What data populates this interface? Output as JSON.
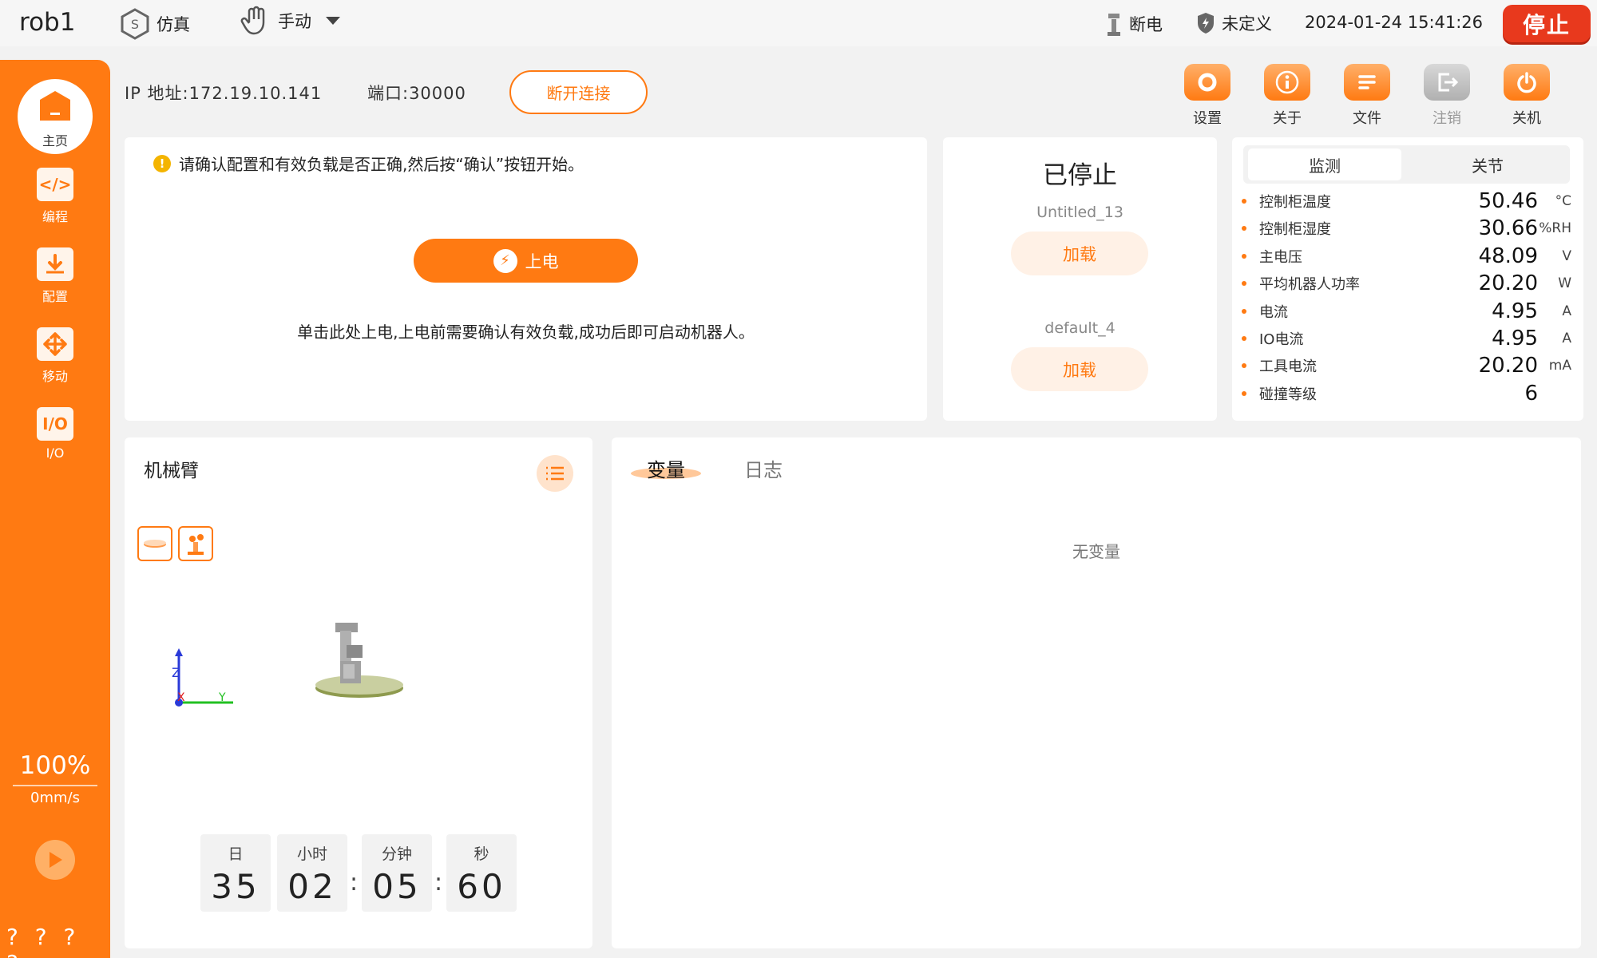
{
  "topbar": {
    "robot_name": "rob1",
    "mode": "仿真",
    "control": "手动",
    "power_status": "断电",
    "safety_status": "未定义",
    "datetime": "2024-01-24 15:41:26",
    "stop_label": "停止"
  },
  "sidebar": {
    "items": [
      {
        "label": "主页"
      },
      {
        "label": "编程",
        "icon_text": "</>"
      },
      {
        "label": "配置"
      },
      {
        "label": "移动"
      },
      {
        "label": "I/O",
        "icon_text": "I/O"
      }
    ],
    "speed_percent": "100%",
    "speed_value": "0mm/s",
    "footer": "? ? ? ?"
  },
  "connection": {
    "ip_label": "IP 地址:172.19.10.141",
    "port_label": "端口:30000",
    "disconnect_label": "断开连接"
  },
  "toolbar": {
    "items": [
      {
        "label": "设置",
        "icon": "gear-icon"
      },
      {
        "label": "关于",
        "icon": "info-icon"
      },
      {
        "label": "文件",
        "icon": "file-icon"
      },
      {
        "label": "注销",
        "icon": "logout-icon"
      },
      {
        "label": "关机",
        "icon": "power-icon"
      }
    ]
  },
  "power_card": {
    "notice": "请确认配置和有效负载是否正确,然后按“确认”按钮开始。",
    "power_button": "上电",
    "hint": "单击此处上电,上电前需要确认有效负载,成功后即可启动机器人。"
  },
  "program_card": {
    "status": "已停止",
    "program_name": "Untitled_13",
    "load_label": "加载",
    "payload_name": "default_4",
    "load_label_2": "加载"
  },
  "monitor_card": {
    "tabs": [
      "监测",
      "关节"
    ],
    "rows": [
      {
        "label": "控制柜温度",
        "value": "50.46",
        "unit": "°C"
      },
      {
        "label": "控制柜湿度",
        "value": "30.66",
        "unit": "%RH"
      },
      {
        "label": "主电压",
        "value": "48.09",
        "unit": "V"
      },
      {
        "label": "平均机器人功率",
        "value": "20.20",
        "unit": "W"
      },
      {
        "label": "电流",
        "value": "4.95",
        "unit": "A"
      },
      {
        "label": "IO电流",
        "value": "4.95",
        "unit": "A"
      },
      {
        "label": "工具电流",
        "value": "20.20",
        "unit": "mA"
      },
      {
        "label": "碰撞等级",
        "value": "6",
        "unit": ""
      }
    ]
  },
  "arm_card": {
    "title": "机械臂",
    "axis_labels": {
      "z": "Z",
      "x": "X",
      "y": "Y"
    },
    "timer": [
      {
        "label": "日",
        "value": "35"
      },
      {
        "label": "小时",
        "value": "02"
      },
      {
        "label": "分钟",
        "value": "05"
      },
      {
        "label": "秒",
        "value": "60"
      }
    ],
    "separator": ":"
  },
  "vars_card": {
    "tabs": [
      "变量",
      "日志"
    ],
    "empty_text": "无变量"
  },
  "colors": {
    "accent": "#ff7a12",
    "stop": "#e8391d"
  }
}
